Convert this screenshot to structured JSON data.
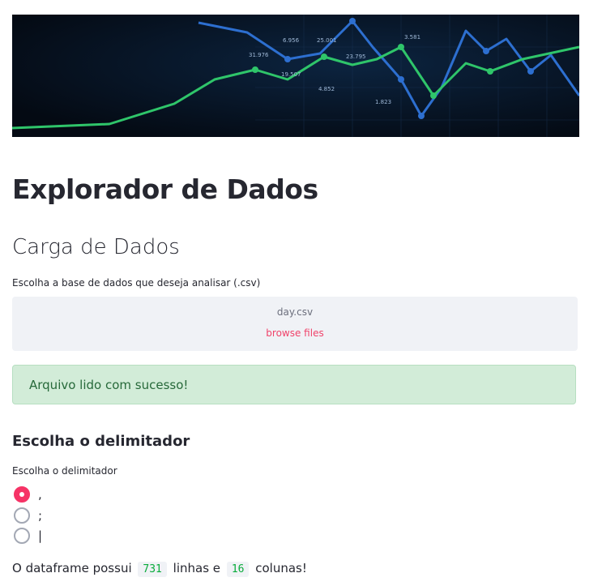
{
  "banner": {
    "labels": [
      "6.956",
      "25.001",
      "3.581",
      "31.976",
      "23.795",
      "19.507",
      "4.852",
      "1.823"
    ]
  },
  "page": {
    "title": "Explorador de Dados"
  },
  "section": {
    "title": "Carga de Dados"
  },
  "uploader": {
    "label": "Escolha a base de dados que deseja analisar (.csv)",
    "filename": "day.csv",
    "browse": "browse files"
  },
  "alert": {
    "message": "Arquivo lido com sucesso!"
  },
  "delimiter": {
    "subheader": "Escolha o delimitador",
    "label": "Escolha o delimitador",
    "options": [
      {
        "value": ",",
        "selected": true
      },
      {
        "value": ";",
        "selected": false
      },
      {
        "value": "|",
        "selected": false
      }
    ]
  },
  "summary": {
    "prefix": "O dataframe possui",
    "rows": "731",
    "middle": "linhas e",
    "cols": "16",
    "suffix": "colunas!"
  },
  "colors": {
    "accent": "#f63366",
    "success_bg": "#d2ecd8",
    "success_text": "#27693a"
  }
}
